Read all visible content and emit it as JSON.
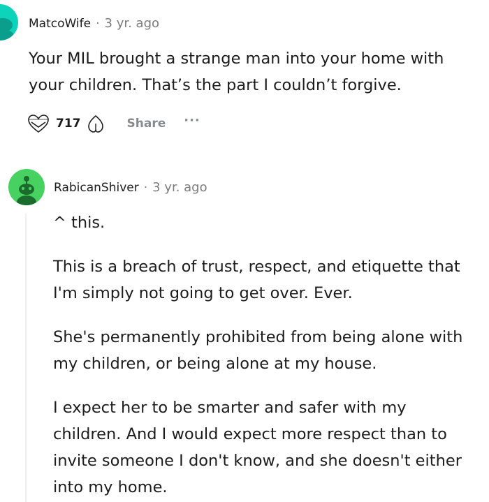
{
  "comments": [
    {
      "author": "MatcoWife",
      "separator": "·",
      "time": "3 yr. ago",
      "body": "Your MIL brought a strange man into your home with your children. That’s the part I couldn’t forgive.",
      "avatar_color": "#0dd3bb",
      "actions": {
        "upvote_icon": "upvote-heart-icon",
        "votes": "717",
        "downvote_icon": "downvote-icon",
        "share_label": "Share",
        "more_label": "···"
      }
    },
    {
      "author": "RabicanShiver",
      "separator": "·",
      "time": "3 yr. ago",
      "avatar_color": "#46d160",
      "paragraphs": [
        "^ this.",
        "This is a breach of trust, respect, and etiquette that I'm simply not going to get over. Ever.",
        "She's permanently prohibited from being alone with my children, or being alone at my house.",
        "I expect her to be smarter and safer with my children. And I would expect more respect than to invite someone I don't know, and she doesn't either into my home."
      ]
    }
  ]
}
